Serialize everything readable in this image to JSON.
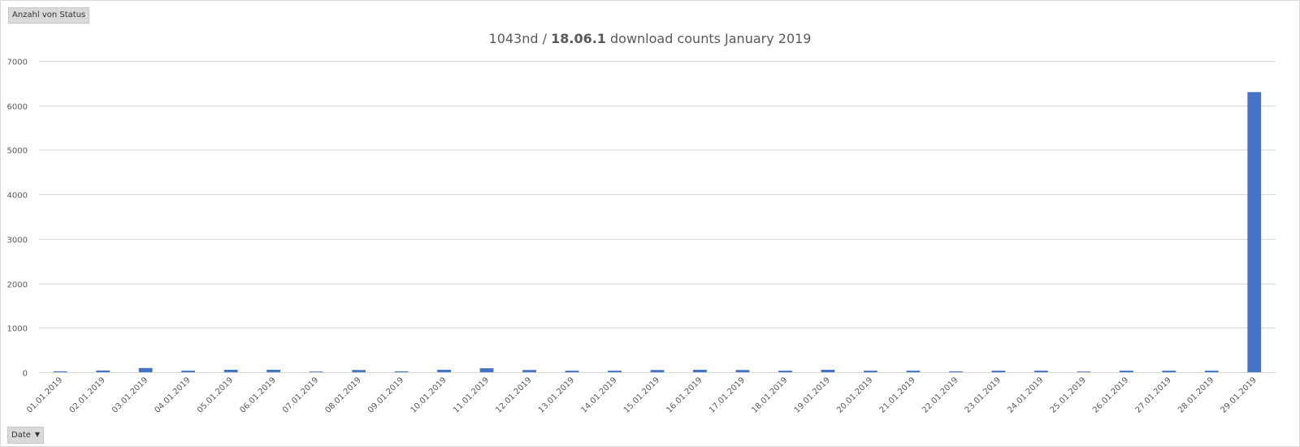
{
  "pivot": {
    "value_field": "Anzahl von Status",
    "axis_field": "Date"
  },
  "chart_data": {
    "type": "bar",
    "title_parts": [
      "1043nd / ",
      "18.06.1",
      " download counts January 2019"
    ],
    "ylim": [
      0,
      7000
    ],
    "yticks": [
      0,
      1000,
      2000,
      3000,
      4000,
      5000,
      6000,
      7000
    ],
    "grid": true,
    "legend": "none",
    "bar_color": "#4472c4",
    "categories": [
      "01.01.2019",
      "02.01.2019",
      "03.01.2019",
      "04.01.2019",
      "05.01.2019",
      "06.01.2019",
      "07.01.2019",
      "08.01.2019",
      "09.01.2019",
      "10.01.2019",
      "11.01.2019",
      "12.01.2019",
      "13.01.2019",
      "14.01.2019",
      "15.01.2019",
      "16.01.2019",
      "17.01.2019",
      "18.01.2019",
      "19.01.2019",
      "20.01.2019",
      "21.01.2019",
      "22.01.2019",
      "23.01.2019",
      "24.01.2019",
      "25.01.2019",
      "26.01.2019",
      "27.01.2019",
      "28.01.2019",
      "29.01.2019"
    ],
    "values": [
      20,
      40,
      95,
      35,
      55,
      55,
      15,
      50,
      20,
      55,
      90,
      50,
      35,
      35,
      50,
      55,
      50,
      35,
      55,
      35,
      35,
      20,
      35,
      35,
      15,
      35,
      35,
      35,
      6300
    ]
  }
}
